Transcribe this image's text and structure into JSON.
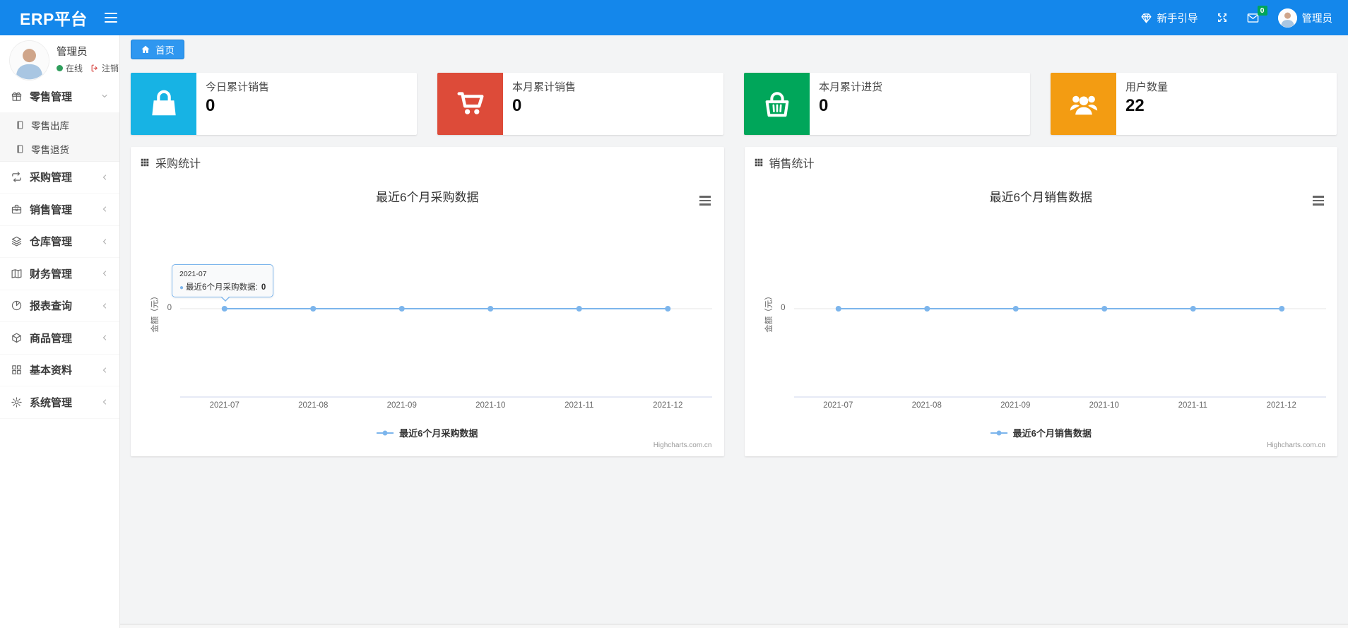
{
  "navbar": {
    "brand": "ERP平台",
    "guide_label": "新手引导",
    "mail_badge": "0",
    "user_name": "管理员"
  },
  "sidebar": {
    "user": {
      "name": "管理员",
      "status": "在线",
      "logout_label": "注销"
    },
    "menu": [
      {
        "label": "零售管理",
        "icon": "gift-icon",
        "state": "expanded",
        "children": [
          {
            "label": "零售出库",
            "icon": "file-icon"
          },
          {
            "label": "零售退货",
            "icon": "file-icon"
          }
        ]
      },
      {
        "label": "采购管理",
        "icon": "repeat-icon",
        "state": "collapsed"
      },
      {
        "label": "销售管理",
        "icon": "briefcase-icon",
        "state": "collapsed"
      },
      {
        "label": "仓库管理",
        "icon": "layers-icon",
        "state": "collapsed"
      },
      {
        "label": "财务管理",
        "icon": "book-icon",
        "state": "collapsed"
      },
      {
        "label": "报表查询",
        "icon": "pie-chart-icon",
        "state": "collapsed"
      },
      {
        "label": "商品管理",
        "icon": "box-icon",
        "state": "collapsed"
      },
      {
        "label": "基本资料",
        "icon": "grid-icon",
        "state": "collapsed"
      },
      {
        "label": "系统管理",
        "icon": "gear-icon",
        "state": "collapsed"
      }
    ]
  },
  "breadcrumb": {
    "home_label": "首页"
  },
  "cards": [
    {
      "label": "今日累计销售",
      "value": "0",
      "color": "#17b3e4",
      "icon": "shopping-bag-icon"
    },
    {
      "label": "本月累计销售",
      "value": "0",
      "color": "#dd4b39",
      "icon": "shopping-cart-icon"
    },
    {
      "label": "本月累计进货",
      "value": "0",
      "color": "#00a65a",
      "icon": "shopping-basket-icon"
    },
    {
      "label": "用户数量",
      "value": "22",
      "color": "#f39c12",
      "icon": "users-icon"
    }
  ],
  "chart_data": [
    {
      "type": "line",
      "panel_title": "采购统计",
      "title": "最近6个月采购数据",
      "categories": [
        "2021-07",
        "2021-08",
        "2021-09",
        "2021-10",
        "2021-11",
        "2021-12"
      ],
      "series": [
        {
          "name": "最近6个月采购数据",
          "values": [
            0,
            0,
            0,
            0,
            0,
            0
          ]
        }
      ],
      "xlabel": "",
      "ylabel": "金额（元）",
      "yticks": [
        "0"
      ],
      "grid": false,
      "legend_position": "bottom",
      "line_color": "#7cb5ec",
      "credits": "Highcharts.com.cn",
      "tooltip": {
        "category": "2021-07",
        "series": "最近6个月采购数据",
        "value": "0",
        "point_index": 0
      }
    },
    {
      "type": "line",
      "panel_title": "销售统计",
      "title": "最近6个月销售数据",
      "categories": [
        "2021-07",
        "2021-08",
        "2021-09",
        "2021-10",
        "2021-11",
        "2021-12"
      ],
      "series": [
        {
          "name": "最近6个月销售数据",
          "values": [
            0,
            0,
            0,
            0,
            0,
            0
          ]
        }
      ],
      "xlabel": "",
      "ylabel": "金额（元）",
      "yticks": [
        "0"
      ],
      "grid": false,
      "legend_position": "bottom",
      "line_color": "#7cb5ec",
      "credits": "Highcharts.com.cn",
      "tooltip": null
    }
  ]
}
